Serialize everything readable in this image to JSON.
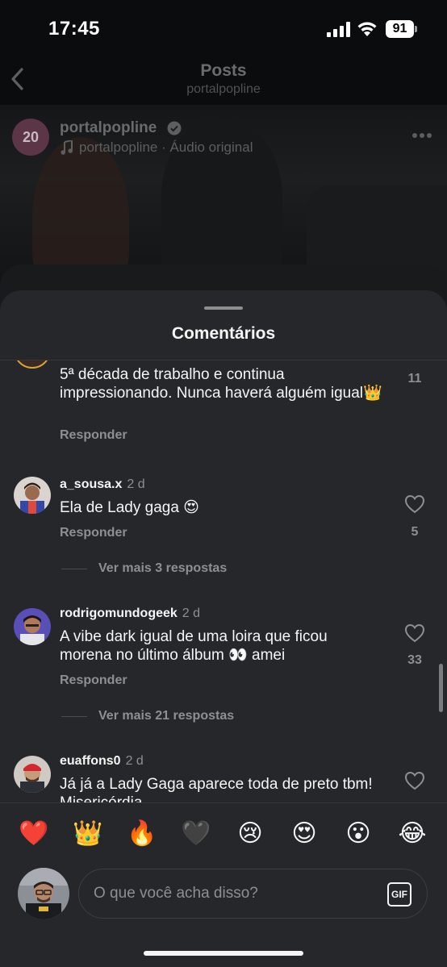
{
  "status_bar": {
    "time": "17:45",
    "battery": "91"
  },
  "header": {
    "title": "Posts",
    "subtitle": "portalpopline"
  },
  "post": {
    "username": "portalpopline",
    "avatar_text": "20",
    "audio": "portalpopline · Áudio original"
  },
  "sheet": {
    "title": "Comentários",
    "comments": [
      {
        "text": "5ª década de trabalho e continua impressionando. Nunca haverá alguém igual👑",
        "reply_label": "Responder",
        "likes": "11"
      },
      {
        "username": "a_sousa.x",
        "time": "2 d",
        "text": "Ela de Lady gaga 😍",
        "reply_label": "Responder",
        "likes": "5",
        "more_replies": "Ver mais 3 respostas"
      },
      {
        "username": "rodrigomundogeek",
        "time": "2 d",
        "text": "A vibe dark igual de uma loira que ficou morena no último álbum 👀 amei",
        "reply_label": "Responder",
        "likes": "33",
        "more_replies": "Ver mais 21 respostas"
      },
      {
        "username": "euaffons0",
        "time": "2 d",
        "text": "Já já a Lady Gaga aparece toda de preto tbm! Misericórdia"
      }
    ],
    "emojis": [
      "❤️",
      "👑",
      "🔥",
      "🖤",
      "😢",
      "😍",
      "😮",
      "😂"
    ],
    "input_placeholder": "O que você acha disso?",
    "gif_label": "GIF"
  },
  "colors": {
    "sheet_bg": "#25272a",
    "text_primary": "#f5f5f5",
    "text_secondary": "#8e8f92"
  }
}
